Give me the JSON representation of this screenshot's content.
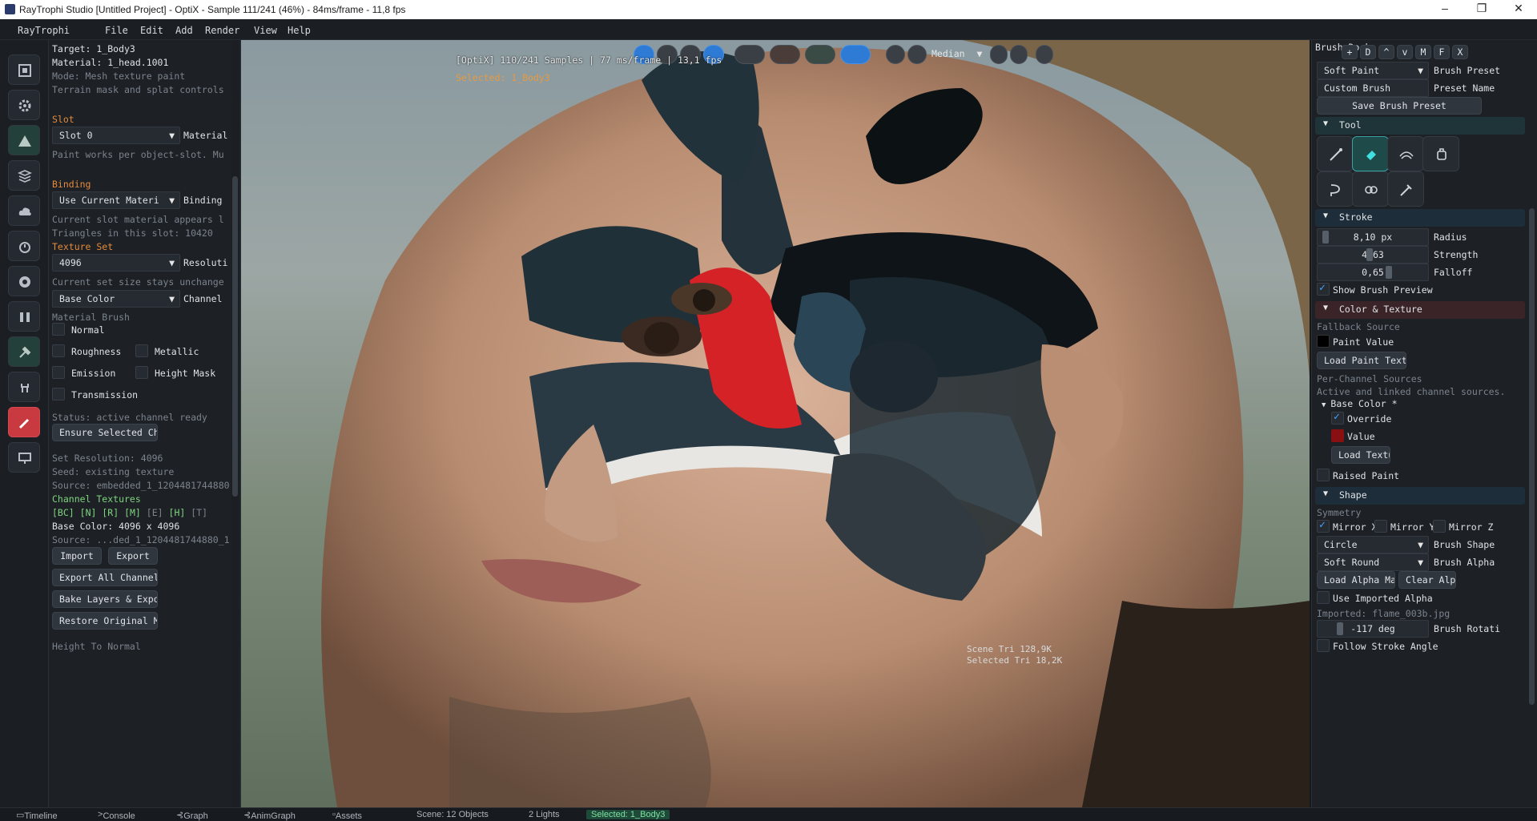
{
  "window": {
    "title": "RayTrophi Studio [Untitled Project] - OptiX - Sample 111/241 (46%) - 84ms/frame - 11,8 fps",
    "controls": [
      "–",
      "❐",
      "✕"
    ]
  },
  "menubar": {
    "brand": "RayTrophi",
    "items": [
      "File",
      "Edit",
      "Add",
      "Render",
      "View",
      "Help"
    ]
  },
  "left_panel": {
    "target": "Target: 1_Body3",
    "material": "Material: 1_head.1001",
    "mode": "Mode: Mesh texture paint",
    "terrain": "Terrain mask and splat controls",
    "slot_header": "Slot",
    "slot_value": "Slot 0",
    "slot_label": "Material",
    "slot_note": "Paint works per object-slot. Mu",
    "binding_header": "Binding",
    "binding_value": "Use Current Materi",
    "binding_label": "Binding",
    "binding_note1": "Current slot material appears l",
    "binding_note2": "Triangles in this slot: 10420",
    "texset_header": "Texture Set",
    "resolution_value": "4096",
    "resolution_label": "Resoluti",
    "resolution_note": "Current set size stays unchange",
    "channel_value": "Base Color",
    "channel_label": "Channel",
    "material_brush": "Material Brush",
    "checks": {
      "normal": "Normal",
      "roughness": "Roughness",
      "metallic": "Metallic",
      "emission": "Emission",
      "height_mask": "Height Mask",
      "transmission": "Transmission"
    },
    "status": "Status: active channel ready",
    "ensure_btn": "Ensure Selected Channe",
    "set_resolution": "Set Resolution: 4096",
    "seed": "Seed: existing texture",
    "source": "Source: embedded_1_1204481744880",
    "channel_textures": "Channel Textures",
    "channel_codes": [
      "[BC]",
      "[N]",
      "[R]",
      "[M]",
      "[E]",
      "[H]",
      "[T]"
    ],
    "base_color_size": "Base Color: 4096 x 4096",
    "source2": "Source: ...ded_1_1204481744880_1",
    "import_btn": "Import",
    "export_btn": "Export",
    "export_all_btn": "Export All Channels",
    "bake_btn": "Bake Layers & Export",
    "restore_btn": "Restore Original Mater",
    "height_to_normal": "Height To Normal"
  },
  "viewport": {
    "overlay_stats": "[OptiX] 110/241 Samples | 77 ms/frame | 13,1 fps",
    "overlay_selected": "Selected: 1_Body3",
    "denoiser": "Median",
    "scene_tri": "Scene Tri  128,9K",
    "selected_tri": "Selected Tri  18,2K"
  },
  "right_panel": {
    "title": "Brush Dock",
    "dock_buttons": [
      "+",
      "D",
      "^",
      "v",
      "M",
      "F",
      "X"
    ],
    "preset_value": "Soft Paint",
    "preset_label": "Brush Preset",
    "preset_name_value": "Custom Brush",
    "preset_name_label": "Preset Name",
    "save_preset": "Save Brush Preset",
    "tool_header": "Tool",
    "stroke_header": "Stroke",
    "radius_value": "8,10 px",
    "radius_label": "Radius",
    "radius_level": 0.02,
    "strength_value": "4,63",
    "strength_label": "Strength",
    "strength_level": 0.46,
    "falloff_value": "0,65",
    "falloff_label": "Falloff",
    "falloff_level": 0.65,
    "show_preview": "Show Brush Preview",
    "color_header": "Color & Texture",
    "fallback_source": "Fallback Source",
    "paint_value": "Paint Value",
    "load_paint_texture": "Load Paint Texture",
    "per_channel": "Per-Channel Sources",
    "active_linked": "Active and linked channel sources.",
    "base_color_node": "Base Color  *",
    "override": "Override",
    "value": "Value",
    "load_texture": "Load Texture",
    "raised_paint": "Raised Paint",
    "shape_header": "Shape",
    "symmetry": "Symmetry",
    "mirror_x": "Mirror X",
    "mirror_y": "Mirror Y",
    "mirror_z": "Mirror Z",
    "shape_value": "Circle",
    "shape_label": "Brush Shape",
    "alpha_value": "Soft Round",
    "alpha_label": "Brush Alpha",
    "load_alpha_mask": "Load Alpha Mask",
    "clear_alpha": "Clear Alpha",
    "use_imported_alpha": "Use Imported Alpha",
    "imported": "Imported: flame_003b.jpg",
    "rotation_value": "-117 deg",
    "rotation_label": "Brush Rotati",
    "follow_stroke": "Follow Stroke Angle"
  },
  "statusbar": {
    "tabs": [
      "Timeline",
      "Console",
      "Graph",
      "AnimGraph",
      "Assets"
    ],
    "scene": "Scene: 12 Objects",
    "lights": "2 Lights",
    "selected": "Selected: 1_Body3"
  },
  "colors": {
    "accent_orange": "#e58a3a",
    "accent_blue": "#2e7bd6",
    "active_teal": "#3ca0a0",
    "paint_value_swatch": "#000000",
    "override_value_swatch": "#8a0f12",
    "brush_red_icon": "#c93a40"
  }
}
